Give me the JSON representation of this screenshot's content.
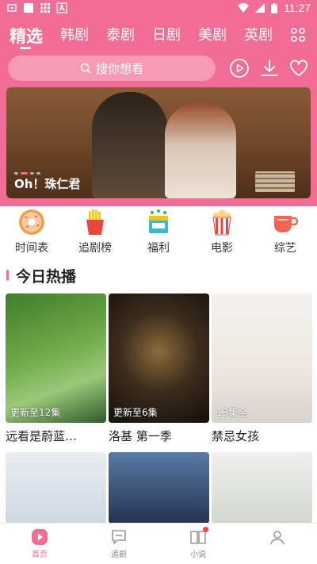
{
  "status_bar": {
    "time": "11:27"
  },
  "tabs": [
    {
      "label": "精选",
      "active": true
    },
    {
      "label": "韩剧"
    },
    {
      "label": "泰剧"
    },
    {
      "label": "日剧"
    },
    {
      "label": "美剧"
    },
    {
      "label": "英剧"
    }
  ],
  "search": {
    "placeholder": "搜你想看"
  },
  "banner": {
    "title": "Oh！珠仁君"
  },
  "shortcuts": [
    {
      "label": "时间表",
      "icon": "donut-icon"
    },
    {
      "label": "追剧榜",
      "icon": "fries-icon"
    },
    {
      "label": "福利",
      "icon": "gift-box-icon"
    },
    {
      "label": "电影",
      "icon": "popcorn-icon"
    },
    {
      "label": "综艺",
      "icon": "cup-icon"
    }
  ],
  "section": {
    "title": "今日热播"
  },
  "cards": [
    {
      "title": "远看是蔚蓝…",
      "badge": "更新至12集"
    },
    {
      "title": "洛基 第一季",
      "badge": "更新至6集"
    },
    {
      "title": "禁忌女孩",
      "badge": "13集全"
    },
    {
      "title": "",
      "badge": ""
    },
    {
      "title": "",
      "badge": ""
    },
    {
      "title": "",
      "badge": ""
    }
  ],
  "bottom_nav": [
    {
      "label": "首页",
      "icon": "home-play-icon",
      "active": true
    },
    {
      "label": "追剧",
      "icon": "chat-icon"
    },
    {
      "label": "小说",
      "icon": "book-icon"
    },
    {
      "label": "",
      "icon": "profile-icon"
    }
  ],
  "colors": {
    "accent": "#f26d95",
    "search_bg": "#f79ab5"
  }
}
